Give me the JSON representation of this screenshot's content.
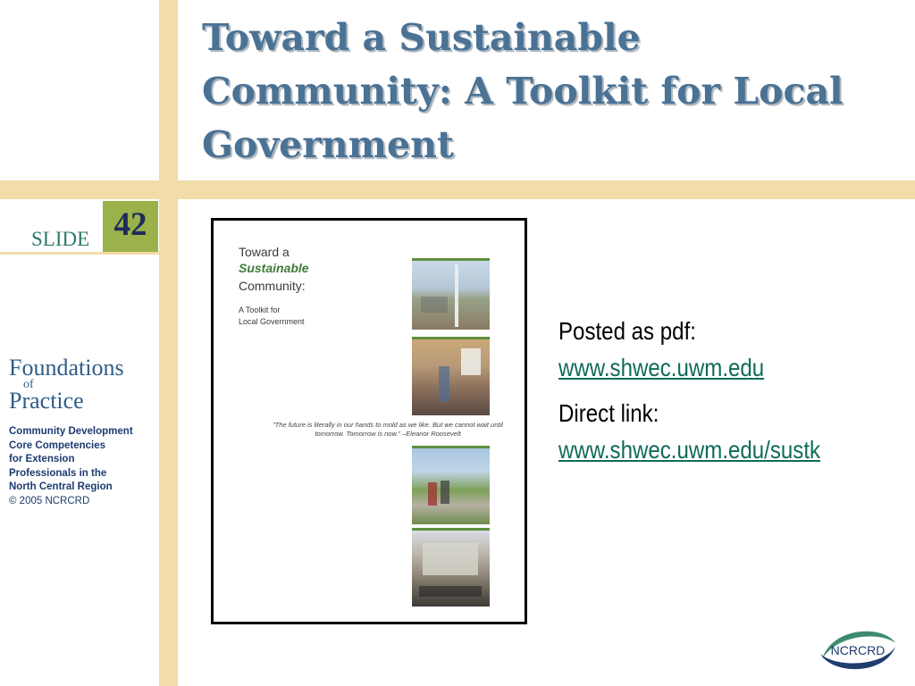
{
  "slide": {
    "title": "Toward a Sustainable Community: A Toolkit for Local Government",
    "slide_label": "SLIDE",
    "slide_number": "42"
  },
  "branding": {
    "foundations_line1": "Foundations",
    "foundations_of": "of",
    "foundations_line3": "Practice",
    "org_lines": [
      "Community Development",
      "Core Competencies",
      "for Extension",
      "Professionals in the",
      "North Central Region"
    ],
    "copyright": "© 2005 NCRCRD",
    "logo_text": "NCRCRD"
  },
  "cover": {
    "title_line1": "Toward a",
    "title_line2": "Sustainable",
    "title_line3": "Community:",
    "subtitle_line1": "A Toolkit for",
    "subtitle_line2": "Local Government",
    "quote": "“The future is literally in our hands to mold as we like. But we cannot wait until tomorrow. Tomorrow is now.” –Eleanor Roosevelt"
  },
  "info": {
    "posted_label": "Posted as pdf:",
    "posted_link": "www.shwec.uwm.edu",
    "direct_label": "Direct link:",
    "direct_link": "www.shwec.uwm.edu/sustk"
  },
  "colors": {
    "title": "#4a7294",
    "accent_bar": "#f2dcaa",
    "slide_box": "#9bb24a",
    "link": "#0f6b5a"
  }
}
